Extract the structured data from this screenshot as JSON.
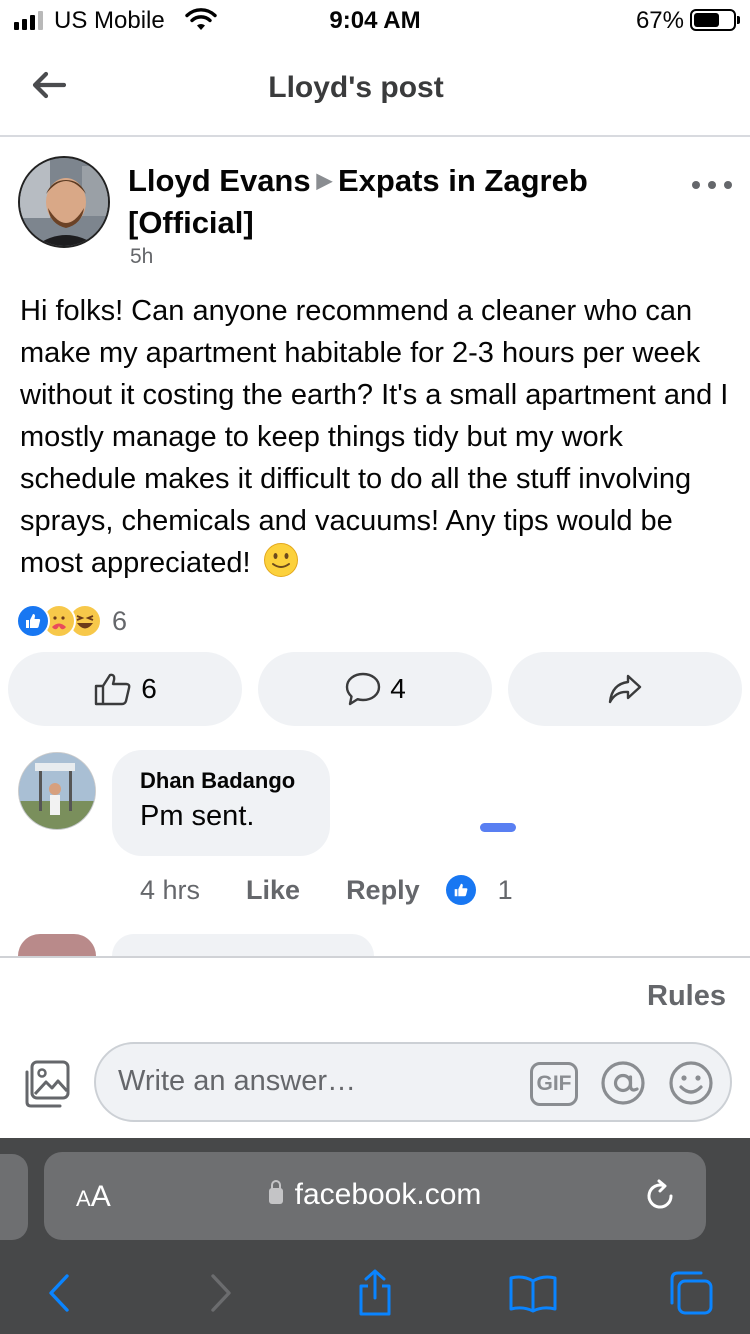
{
  "status_bar": {
    "carrier": "US Mobile",
    "time": "9:04 AM",
    "battery_percent": "67%",
    "battery_level": 0.67,
    "signal_icon": "cellular-signal-icon",
    "wifi_icon": "wifi-icon"
  },
  "header": {
    "title": "Lloyd's post",
    "back_icon": "back-arrow-icon"
  },
  "post": {
    "author": "Lloyd Evans",
    "group": "Expats in Zagreb [Official]",
    "time": "5h",
    "text": "Hi folks! Can anyone recommend a cleaner who can make my apartment habitable for 2-3 hours per week without it costing the earth? It's a small apartment and I mostly manage to keep things tidy but my work schedule makes it difficult to do all the stuff involving sprays, chemicals and vacuums! Any tips would be most appreciated!",
    "reaction_count": "6",
    "reactions": [
      "like",
      "care",
      "haha"
    ]
  },
  "actions": {
    "like_count": "6",
    "comment_count": "4"
  },
  "comment": {
    "author": "Dhan Badango",
    "text": "Pm sent.",
    "time": "4 hrs",
    "like_label": "Like",
    "reply_label": "Reply",
    "reaction_count": "1"
  },
  "composer": {
    "rules_label": "Rules",
    "placeholder": "Write an answer…",
    "gif_label": "GIF"
  },
  "safari": {
    "aa_label_big": "A",
    "aa_label_small": "A",
    "url": "facebook.com"
  },
  "colors": {
    "facebook_blue": "#1877f2",
    "secondary_text": "#65676b",
    "bubble_bg": "#f0f2f5",
    "safari_bg": "#474849",
    "safari_accent": "#0a84ff"
  }
}
